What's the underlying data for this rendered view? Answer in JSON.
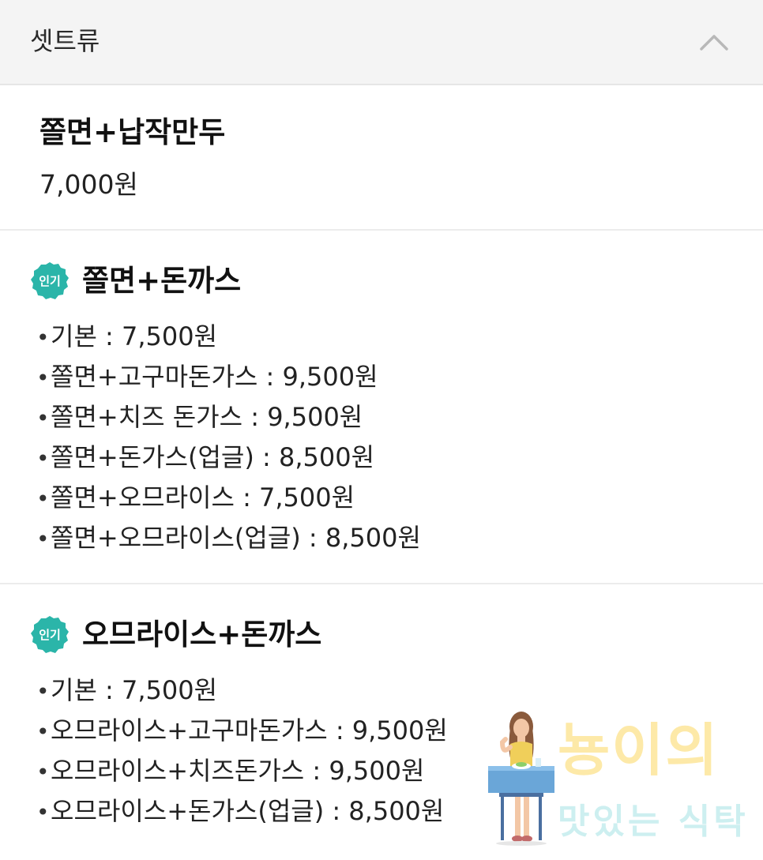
{
  "header": {
    "title": "셋트류"
  },
  "items": [
    {
      "name": "쫄면+납작만두",
      "price": "7,000원"
    },
    {
      "badge": "인기",
      "name": "쫄면+돈까스",
      "options": [
        "기본 : 7,500원",
        "쫄면+고구마돈가스 : 9,500원",
        "쫄면+치즈 돈가스 : 9,500원",
        "쫄면+돈가스(업글) : 8,500원",
        "쫄면+오므라이스 : 7,500원",
        "쫄면+오므라이스(업글) : 8,500원"
      ]
    },
    {
      "badge": "인기",
      "name": "오므라이스+돈까스",
      "options": [
        "기본 : 7,500원",
        "오므라이스+고구마돈가스 : 9,500원",
        "오므라이스+치즈돈가스 : 9,500원",
        "오므라이스+돈가스(업글) : 8,500원"
      ]
    }
  ],
  "bullet": "•",
  "watermark": {
    "main": "뇽이의",
    "sub": "맛있는 식탁"
  },
  "colors": {
    "badge_fill": "#2bb5a9",
    "header_bg": "#f4f4f4",
    "divider": "#ececec"
  },
  "icons": {
    "collapse": "chevron-up-icon",
    "badge": "popular-badge-icon"
  }
}
